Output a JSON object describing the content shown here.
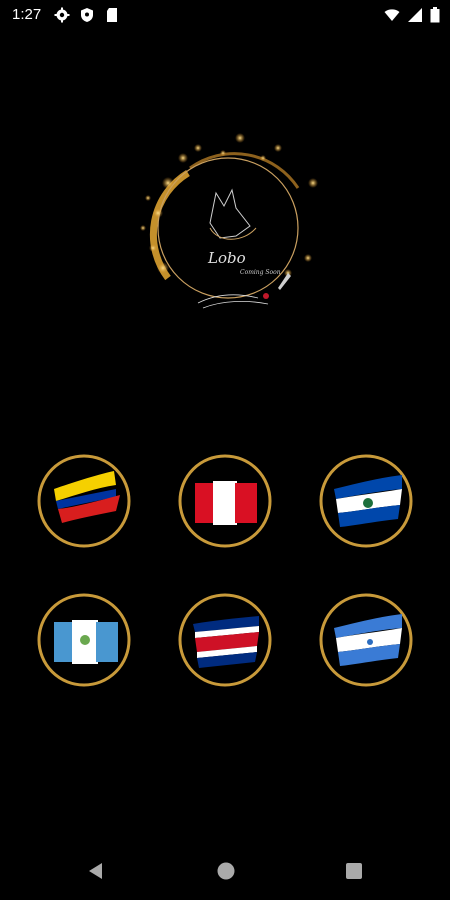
{
  "status_bar": {
    "time": "1:27",
    "left_icons": [
      "gear-icon",
      "shield-icon",
      "sd-card-icon"
    ],
    "right_icons": [
      "wifi-icon",
      "signal-icon",
      "battery-icon"
    ]
  },
  "logo": {
    "script_text": "Lobo",
    "sub_text": "Coming Soon",
    "accent_color": "#d4a23a"
  },
  "flags": [
    {
      "name": "colombia",
      "colors": [
        "#f5d000",
        "#0033a0",
        "#d81e1e"
      ]
    },
    {
      "name": "peru",
      "colors": [
        "#d91023",
        "#ffffff",
        "#d91023"
      ]
    },
    {
      "name": "el-salvador",
      "colors": [
        "#0047ab",
        "#ffffff",
        "#0047ab"
      ]
    },
    {
      "name": "guatemala",
      "colors": [
        "#4997d0",
        "#ffffff",
        "#4997d0"
      ]
    },
    {
      "name": "costa-rica",
      "colors": [
        "#002b7f",
        "#ffffff",
        "#ce1126"
      ]
    },
    {
      "name": "nicaragua",
      "colors": [
        "#3a7bd5",
        "#ffffff",
        "#3a7bd5"
      ]
    }
  ],
  "colors": {
    "background": "#000000",
    "ring_gold": "#c89a3a"
  },
  "nav_bar": {
    "icons": [
      "back-icon",
      "home-icon",
      "recents-icon"
    ]
  }
}
